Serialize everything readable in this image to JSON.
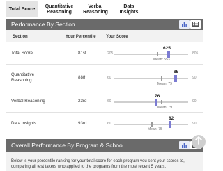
{
  "tabs": [
    {
      "label": "Total Score",
      "active": true
    },
    {
      "label": "Quantitative Reasoning",
      "active": false
    },
    {
      "label": "Verbal Reasoning",
      "active": false
    },
    {
      "label": "Data Insights",
      "active": false
    }
  ],
  "section1": {
    "title": "Performance By Section",
    "columns": {
      "section": "Section",
      "percentile": "Your Percentile",
      "score": "Your Score"
    },
    "rows": [
      {
        "name": "Total Score",
        "percentile": "81st",
        "min": "205",
        "max": "805",
        "score": "625",
        "mean": "Mean: 553"
      },
      {
        "name": "Quantitative Reasoning",
        "percentile": "88th",
        "min": "60",
        "max": "90",
        "score": "85",
        "mean": "Mean: 79"
      },
      {
        "name": "Verbal Reasoning",
        "percentile": "23rd",
        "min": "60",
        "max": "90",
        "score": "76",
        "mean": "Mean: 79"
      },
      {
        "name": "Data Insights",
        "percentile": "93rd",
        "min": "60",
        "max": "90",
        "score": "82",
        "mean": "Mean: 75"
      }
    ]
  },
  "section2": {
    "title": "Overall Performance By Program & School",
    "description": "Below is your percentile ranking for your total score for each program you sent your scores to, comparing all test takers who applied to the programs from the most recent 5 years."
  },
  "icons": {
    "chart_view": "bar-chart-icon",
    "table_view": "table-icon",
    "scroll": "arrow-up-icon"
  },
  "colors": {
    "accent": "#7b7bd2",
    "header_bar": "#6a6a6a"
  }
}
